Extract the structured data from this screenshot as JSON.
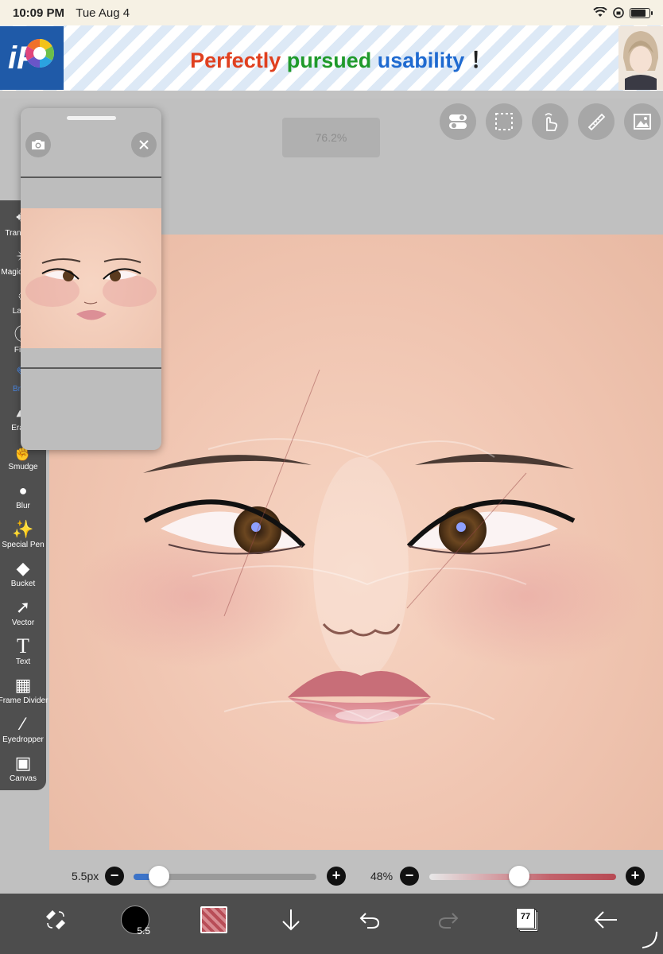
{
  "status_bar": {
    "time": "10:09 PM",
    "date": "Tue Aug 4"
  },
  "ad": {
    "word1": "Perfectly",
    "word2": "pursued",
    "word3": "usability",
    "word4": "！",
    "logo_text": "iP"
  },
  "canvas": {
    "zoom": "76.2%"
  },
  "tools": [
    {
      "label": "Transform",
      "icon": "transform-icon"
    },
    {
      "label": "Magic Wand",
      "icon": "magic-wand-icon"
    },
    {
      "label": "Lasso",
      "icon": "lasso-icon"
    },
    {
      "label": "Filter",
      "icon": "filter-icon"
    },
    {
      "label": "Brush",
      "icon": "brush-icon"
    },
    {
      "label": "Eraser",
      "icon": "eraser-icon"
    },
    {
      "label": "Smudge",
      "icon": "smudge-icon"
    },
    {
      "label": "Blur",
      "icon": "blur-icon"
    },
    {
      "label": "Special Pen",
      "icon": "special-pen-icon"
    },
    {
      "label": "Bucket",
      "icon": "bucket-icon"
    },
    {
      "label": "Vector",
      "icon": "vector-icon"
    },
    {
      "label": "Text",
      "icon": "text-icon"
    },
    {
      "label": "Frame Divider",
      "icon": "frame-divider-icon"
    },
    {
      "label": "Eyedropper",
      "icon": "eyedropper-icon"
    },
    {
      "label": "Canvas",
      "icon": "canvas-icon"
    }
  ],
  "sliders": {
    "brush_size": "5.5px",
    "brush_size_fraction": 0.14,
    "opacity": "48%",
    "opacity_fraction": 0.48
  },
  "bottom_bar": {
    "brush_size_badge": "5.5",
    "layer_count": "77",
    "color_swatch": "#c9666f"
  },
  "colors": {
    "toolbar": "#4f4f4f",
    "accent_slider": "#3c73c8",
    "opacity_slider": "#b74a54"
  }
}
